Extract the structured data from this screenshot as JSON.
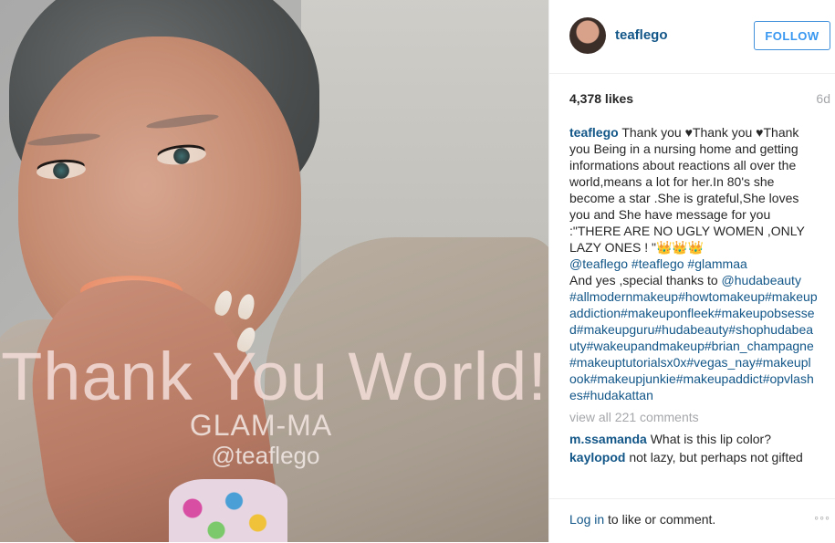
{
  "photo": {
    "overlay_title": "Thank You World!",
    "overlay_subtitle": "GLAM-MA",
    "overlay_handle": "@teaflego"
  },
  "header": {
    "username": "teaflego",
    "follow_label": "FOLLOW"
  },
  "stats": {
    "likes": "4,378 likes",
    "age": "6d"
  },
  "caption": {
    "username": "teaflego",
    "text": "Thank you ♥Thank you ♥Thank you Being in a nursing home and getting informations about reactions all over the world,means a lot for her.In 80's she become a star .She is grateful,She loves you and She have message for you :\"THERE ARE NO UGLY WOMEN ,ONLY LAZY ONES ! \"👑👑👑",
    "tags1": "@teaflego #teaflego #glammaa",
    "thanks_prefix": "And yes ,special thanks to ",
    "tags2": "@hudabeauty #allmodernmakeup#howtomakeup#makeupaddiction#makeuponfleek#makeupobsessed#makeupguru#hudabeauty#shophudabeauty#wakeupandmakeup#brian_champagne#makeuptutorialsx0x#vegas_nay#makeuplook#makeupjunkie#makeupaddict#opvlashes#hudakattan"
  },
  "view_all": "view all 221 comments",
  "comments": [
    {
      "user": "m.ssamanda",
      "text": "What is this lip color?"
    },
    {
      "user": "kaylopod",
      "text": "not lazy, but perhaps not gifted"
    }
  ],
  "footer": {
    "login_link": "Log in",
    "login_rest": " to like or comment.",
    "more": "◦◦◦"
  }
}
